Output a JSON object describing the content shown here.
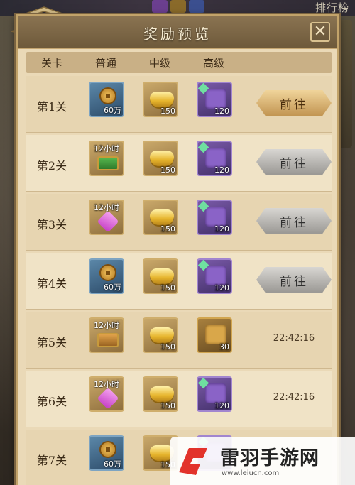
{
  "top_bar": {
    "rank_label": "排行榜"
  },
  "dialog": {
    "title": "奖励预览",
    "close_symbol": "✕"
  },
  "columns": [
    "关卡",
    "普通",
    "中级",
    "高级"
  ],
  "rows": [
    {
      "stage": "第1关",
      "normal": {
        "kind": "copper-coin",
        "qty": "60万"
      },
      "mid": {
        "kind": "gold-ingot",
        "qty": "150"
      },
      "high": {
        "kind": "purple-puzzle",
        "qty": "120"
      },
      "action": {
        "type": "button",
        "label": "前往",
        "style": "gold"
      }
    },
    {
      "stage": "第2关",
      "normal": {
        "kind": "green-chest",
        "timer": "12小时"
      },
      "mid": {
        "kind": "gold-ingot",
        "qty": "150"
      },
      "high": {
        "kind": "purple-puzzle",
        "qty": "120"
      },
      "action": {
        "type": "button",
        "label": "前往",
        "style": "gray"
      }
    },
    {
      "stage": "第3关",
      "normal": {
        "kind": "pink-crystal",
        "timer": "12小时"
      },
      "mid": {
        "kind": "gold-ingot",
        "qty": "150"
      },
      "high": {
        "kind": "purple-puzzle",
        "qty": "120"
      },
      "action": {
        "type": "button",
        "label": "前往",
        "style": "gray"
      }
    },
    {
      "stage": "第4关",
      "normal": {
        "kind": "copper-coin",
        "qty": "60万"
      },
      "mid": {
        "kind": "gold-ingot",
        "qty": "150"
      },
      "high": {
        "kind": "purple-puzzle",
        "qty": "120"
      },
      "action": {
        "type": "button",
        "label": "前往",
        "style": "gray"
      }
    },
    {
      "stage": "第5关",
      "normal": {
        "kind": "orange-chest",
        "timer": "12小时"
      },
      "mid": {
        "kind": "gold-ingot",
        "qty": "150"
      },
      "high": {
        "kind": "gold-puzzle",
        "qty": "30"
      },
      "action": {
        "type": "countdown",
        "label": "22:42:16"
      }
    },
    {
      "stage": "第6关",
      "normal": {
        "kind": "pink-crystal",
        "timer": "12小时"
      },
      "mid": {
        "kind": "gold-ingot",
        "qty": "150"
      },
      "high": {
        "kind": "purple-puzzle",
        "qty": "120"
      },
      "action": {
        "type": "countdown",
        "label": "22:42:16"
      }
    },
    {
      "stage": "第7关",
      "normal": {
        "kind": "copper-coin",
        "qty": "60万"
      },
      "mid": {
        "kind": "gold-ingot",
        "qty": "150"
      },
      "high": {
        "kind": "purple-puzzle",
        "qty": ""
      },
      "action": {
        "type": "none",
        "label": ""
      }
    }
  ],
  "watermark": {
    "title": "雷羽手游网",
    "url": "www.leiucn.com"
  },
  "colors": {
    "panel_bg": "#ead9b7",
    "title_bar": "#7c6646",
    "button_gold": "#d9b06a",
    "button_gray": "#b8b6b2"
  }
}
